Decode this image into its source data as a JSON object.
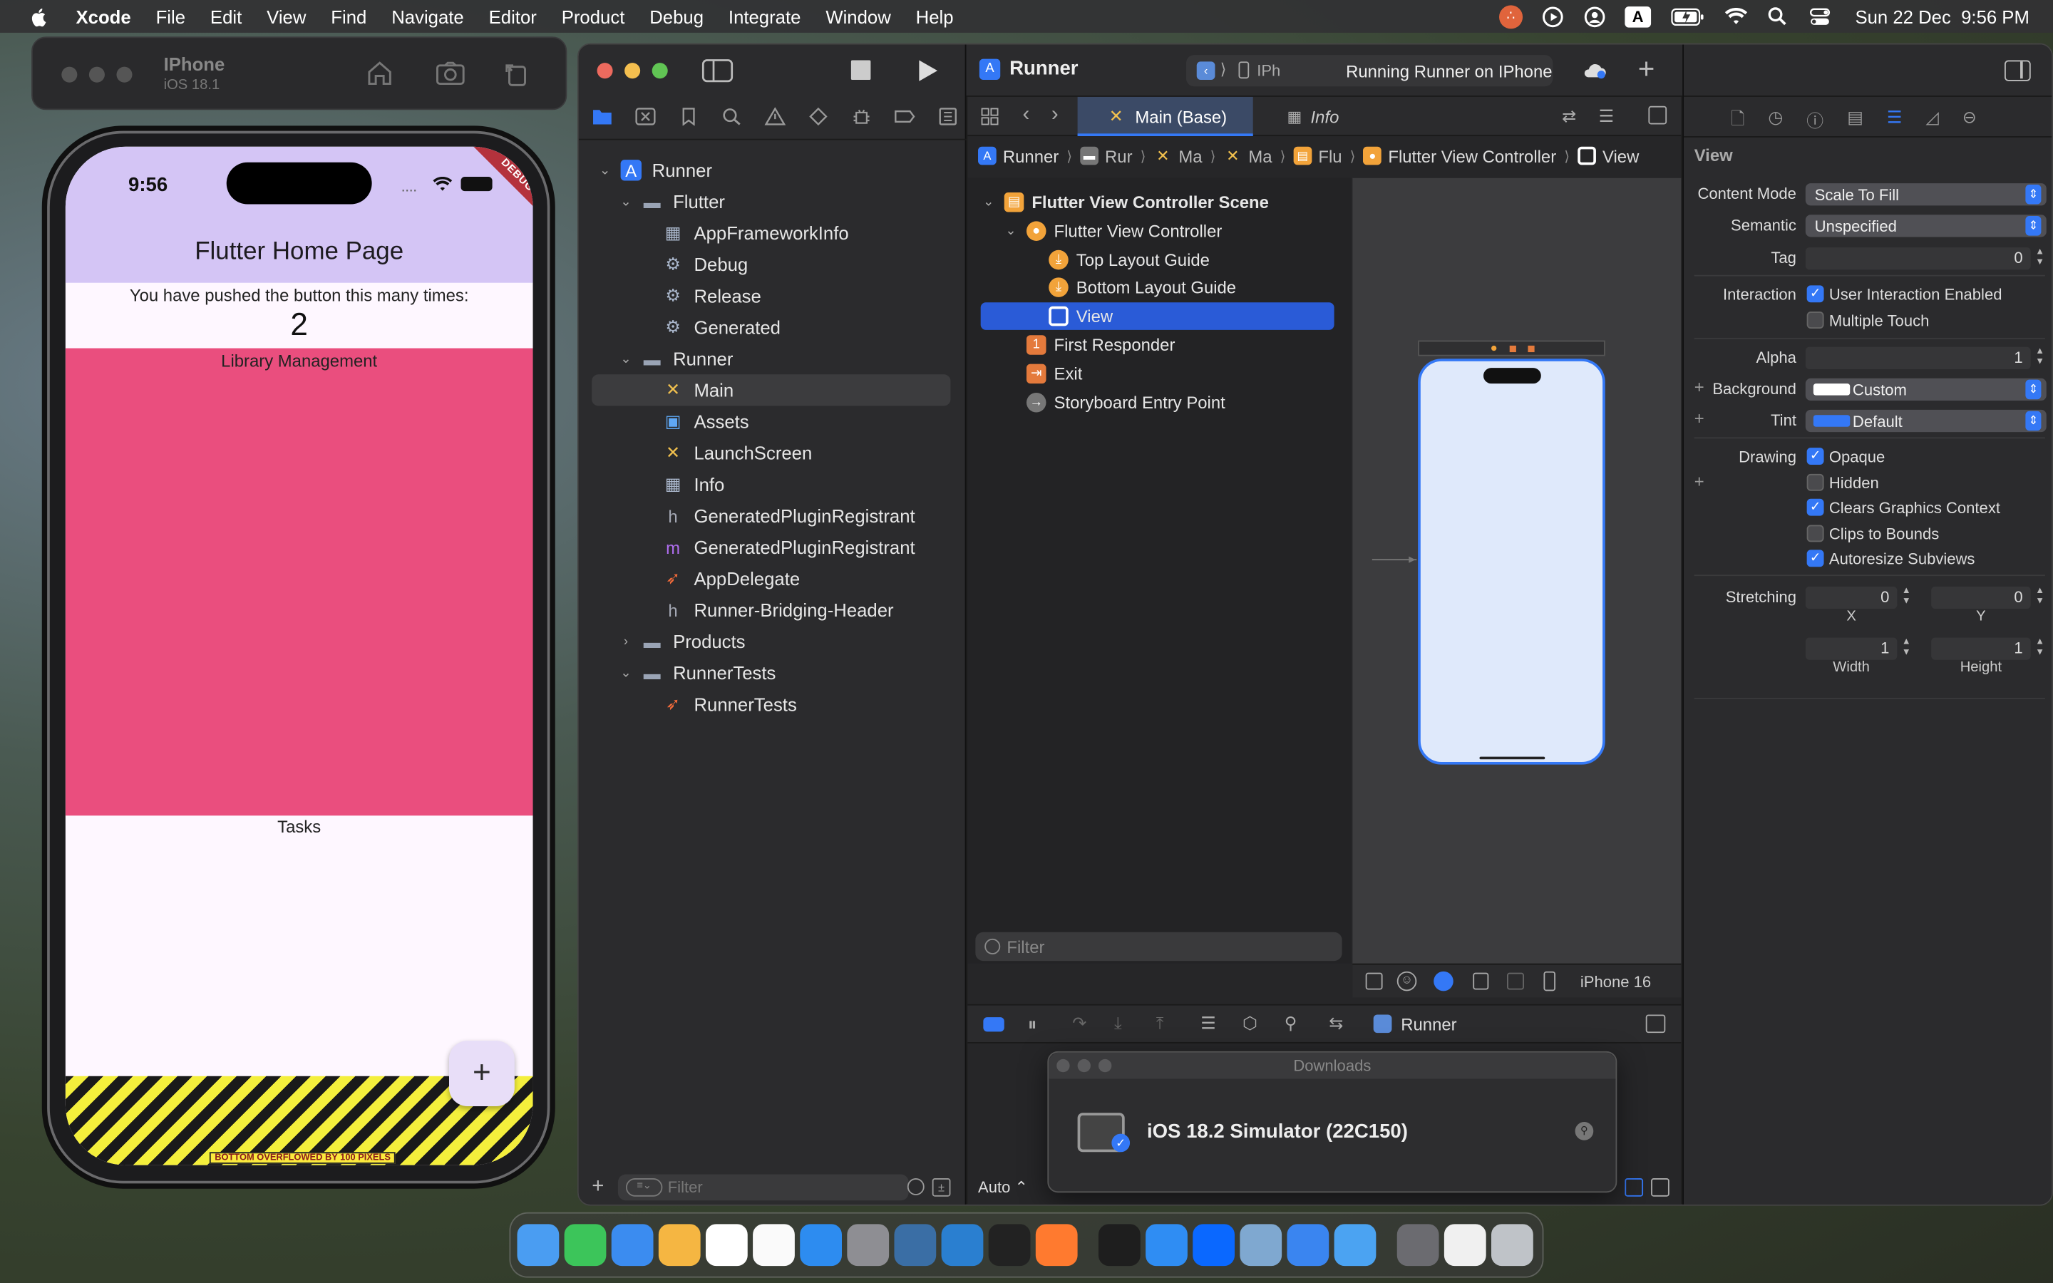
{
  "menubar": {
    "app": "Xcode",
    "items": [
      "File",
      "Edit",
      "View",
      "Find",
      "Navigate",
      "Editor",
      "Product",
      "Debug",
      "Integrate",
      "Window",
      "Help"
    ],
    "datetime": "Sun 22 Dec  9:56 PM",
    "input_source": "A"
  },
  "simulator": {
    "device": "IPhone",
    "os": "iOS 18.1",
    "time": "9:56",
    "debug_badge": "DEBUG",
    "app_title": "Flutter Home Page",
    "counter_text": "You have pushed the button this many times:",
    "counter": "2",
    "section1": "Library Management",
    "section2": "Tasks",
    "overflow_text": "BOTTOM OVERFLOWED BY 100 PIXELS",
    "fab": "+"
  },
  "xcode": {
    "scheme": "Runner",
    "run_destination": "IPh",
    "status": "Running Runner on IPhone",
    "tabs": [
      {
        "label": "Main (Base)",
        "active": true
      },
      {
        "label": "Info",
        "active": false
      }
    ],
    "breadcrumb": [
      "Runner",
      "Rur",
      "Ma",
      "Ma",
      "Flu",
      "Flutter View Controller",
      "View"
    ],
    "navigator": [
      {
        "label": "Runner",
        "indent": 0,
        "disclosure": "open",
        "icon": "project"
      },
      {
        "label": "Flutter",
        "indent": 1,
        "disclosure": "open",
        "icon": "folder"
      },
      {
        "label": "AppFrameworkInfo",
        "indent": 2,
        "icon": "plist"
      },
      {
        "label": "Debug",
        "indent": 2,
        "icon": "xcconfig"
      },
      {
        "label": "Release",
        "indent": 2,
        "icon": "xcconfig"
      },
      {
        "label": "Generated",
        "indent": 2,
        "icon": "xcconfig"
      },
      {
        "label": "Runner",
        "indent": 1,
        "disclosure": "open",
        "icon": "folder"
      },
      {
        "label": "Main",
        "indent": 2,
        "icon": "storyboard",
        "selected": true
      },
      {
        "label": "Assets",
        "indent": 2,
        "icon": "assets"
      },
      {
        "label": "LaunchScreen",
        "indent": 2,
        "icon": "storyboard"
      },
      {
        "label": "Info",
        "indent": 2,
        "icon": "plist"
      },
      {
        "label": "GeneratedPluginRegistrant",
        "indent": 2,
        "icon": "h"
      },
      {
        "label": "GeneratedPluginRegistrant",
        "indent": 2,
        "icon": "m"
      },
      {
        "label": "AppDelegate",
        "indent": 2,
        "icon": "swift"
      },
      {
        "label": "Runner-Bridging-Header",
        "indent": 2,
        "icon": "h"
      },
      {
        "label": "Products",
        "indent": 1,
        "disclosure": "closed",
        "icon": "folder"
      },
      {
        "label": "RunnerTests",
        "indent": 1,
        "disclosure": "open",
        "icon": "folder"
      },
      {
        "label": "RunnerTests",
        "indent": 2,
        "icon": "swift"
      }
    ],
    "nav_filter": "Filter",
    "outline": [
      {
        "label": "Flutter View Controller Scene",
        "indent": 0,
        "icon": "scene",
        "bold": true
      },
      {
        "label": "Flutter View Controller",
        "indent": 1,
        "icon": "vc"
      },
      {
        "label": "Top Layout Guide",
        "indent": 2,
        "icon": "guide"
      },
      {
        "label": "Bottom Layout Guide",
        "indent": 2,
        "icon": "guide"
      },
      {
        "label": "View",
        "indent": 2,
        "icon": "view",
        "selected": true
      },
      {
        "label": "First Responder",
        "indent": 1,
        "icon": "responder"
      },
      {
        "label": "Exit",
        "indent": 1,
        "icon": "exit"
      },
      {
        "label": "Storyboard Entry Point",
        "indent": 1,
        "icon": "entry"
      }
    ],
    "outline_filter": "Filter",
    "device_config": "iPhone 16",
    "debug_target": "Runner",
    "auto_label": "Auto",
    "downloads_title": "Downloads",
    "download_item": "iOS 18.2 Simulator (22C150)",
    "inspector": {
      "header": "View",
      "content_mode_label": "Content Mode",
      "content_mode": "Scale To Fill",
      "semantic_label": "Semantic",
      "semantic": "Unspecified",
      "tag_label": "Tag",
      "tag": "0",
      "interaction_label": "Interaction",
      "user_interaction": "User Interaction Enabled",
      "multiple_touch": "Multiple Touch",
      "alpha_label": "Alpha",
      "alpha": "1",
      "background_label": "Background",
      "background": "Custom",
      "tint_label": "Tint",
      "tint": "Default",
      "drawing_label": "Drawing",
      "opaque": "Opaque",
      "hidden": "Hidden",
      "clears": "Clears Graphics Context",
      "clips": "Clips to Bounds",
      "autoresize": "Autoresize Subviews",
      "stretching_label": "Stretching",
      "x": "0",
      "y": "0",
      "x_label": "X",
      "y_label": "Y",
      "width": "1",
      "height": "1",
      "width_label": "Width",
      "height_label": "Height"
    }
  },
  "colors": {
    "accent": "#3478f6",
    "selection": "#2a5bd7",
    "pink": "#ea4e7e",
    "appbar": "#d4c5f5"
  }
}
